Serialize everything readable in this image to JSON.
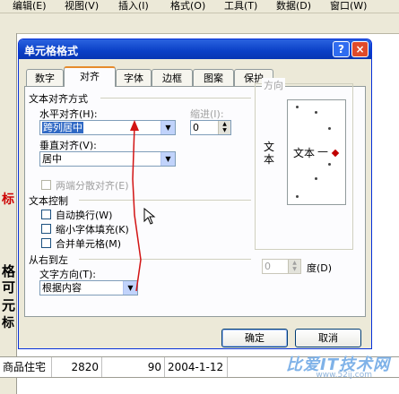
{
  "menubar": {
    "items": [
      "编辑(E)",
      "视图(V)",
      "插入(I)",
      "格式(O)",
      "工具(T)",
      "数据(D)",
      "窗口(W)"
    ]
  },
  "background": {
    "left_fragments": [
      "标",
      "格",
      "可",
      "元",
      "标"
    ],
    "bottom_row": {
      "c1": "商品住宅",
      "c2": "2820",
      "c3": "90",
      "c4": "2004-1-12"
    },
    "watermark": "比爱IT技术网",
    "watermark_url": "www.52ij.com"
  },
  "dialog": {
    "title": "单元格格式",
    "help_label": "?",
    "close_label": "×",
    "tabs": [
      "数字",
      "对齐",
      "字体",
      "边框",
      "图案",
      "保护"
    ],
    "active_tab": "对齐",
    "text_alignment": {
      "group_label": "文本对齐方式",
      "horizontal_label": "水平对齐(H):",
      "horizontal_value": "跨列居中",
      "indent_label": "缩进(I):",
      "indent_value": "0",
      "vertical_label": "垂直对齐(V):",
      "vertical_value": "居中",
      "justify_distributed_label": "两端分散对齐(E)"
    },
    "text_control": {
      "group_label": "文本控制",
      "wrap_text": "自动换行(W)",
      "shrink_to_fit": "缩小字体填充(K)",
      "merge_cells": "合并单元格(M)"
    },
    "right_to_left": {
      "group_label": "从右到左",
      "direction_label": "文字方向(T):",
      "direction_value": "根据内容"
    },
    "orientation": {
      "group_label": "方向",
      "vertical_text": "文本",
      "horizontal_text": "文本",
      "degrees_value": "0",
      "degrees_label": "度(D)"
    },
    "buttons": {
      "ok": "确定",
      "cancel": "取消"
    }
  },
  "colors": {
    "title_bar": "#0a3fc6",
    "accent_tab": "#e68b2c",
    "arrow": "#d21414"
  }
}
